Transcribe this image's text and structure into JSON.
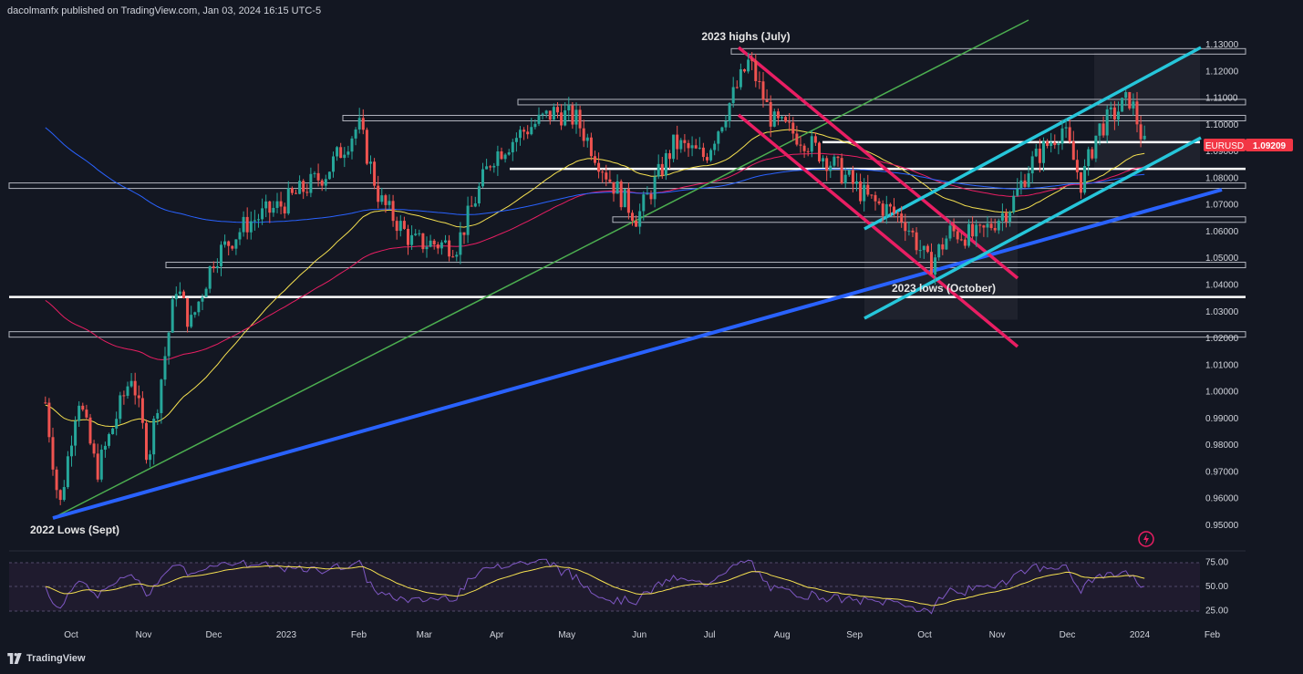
{
  "header": {
    "text": "dacolmanfx published on TradingView.com, Jan 03, 2024 16:15 UTC-5"
  },
  "footer": {
    "brand": "TradingView"
  },
  "colors": {
    "bg": "#131722",
    "up": "#26a69a",
    "down": "#ef5350",
    "ema_fast": "#f5e050",
    "ema_mid": "#e91e63",
    "ema_slow": "#2962ff",
    "rsi": "#7e57c2",
    "channel": "#26c6da",
    "trend": "#2962ff",
    "green_trend": "#4caf50",
    "down_channel": "#e91e63"
  },
  "icons": {
    "lightning": "lightning-icon"
  },
  "chart_data": {
    "type": "candlestick",
    "symbol": "EURUSD",
    "last_price": "1.09209",
    "price_ticks": [
      "1.13000",
      "1.12000",
      "1.11000",
      "1.10000",
      "1.09000",
      "1.08000",
      "1.07000",
      "1.06000",
      "1.05000",
      "1.04000",
      "1.03000",
      "1.02000",
      "1.01000",
      "1.00000",
      "0.99000",
      "0.98000",
      "0.97000",
      "0.96000",
      "0.95000"
    ],
    "ylim": [
      0.945,
      1.132
    ],
    "date_ticks": [
      "Oct",
      "Nov",
      "Dec",
      "2023",
      "Feb",
      "Mar",
      "Apr",
      "May",
      "Jun",
      "Jul",
      "Aug",
      "Sep",
      "Oct",
      "Nov",
      "Dec",
      "2024",
      "Feb"
    ],
    "annotations": [
      "2023 highs (July)",
      "2023 lows (October)",
      "2022 Lows (Sept)"
    ],
    "horizontal_levels": [
      1.1275,
      1.1085,
      1.1025,
      1.0935,
      1.0835,
      1.0775,
      1.0765,
      1.0645,
      1.0475,
      1.0355,
      1.0225,
      1.0205
    ],
    "rsi_ticks": [
      "75.00",
      "50.00",
      "25.00"
    ],
    "rsi_ylim": [
      20,
      80
    ],
    "close_path": [
      [
        "2022-09-20",
        0.996
      ],
      [
        "2022-09-26",
        0.956
      ],
      [
        "2022-10-04",
        0.999
      ],
      [
        "2022-10-12",
        0.97
      ],
      [
        "2022-10-27",
        1.007
      ],
      [
        "2022-11-03",
        0.975
      ],
      [
        "2022-11-15",
        1.04
      ],
      [
        "2022-11-21",
        1.025
      ],
      [
        "2022-12-01",
        1.05
      ],
      [
        "2022-12-15",
        1.063
      ],
      [
        "2022-12-30",
        1.07
      ],
      [
        "2023-01-18",
        1.082
      ],
      [
        "2023-02-01",
        1.1
      ],
      [
        "2023-02-10",
        1.072
      ],
      [
        "2023-02-24",
        1.056
      ],
      [
        "2023-03-15",
        1.055
      ],
      [
        "2023-03-30",
        1.088
      ],
      [
        "2023-04-13",
        1.098
      ],
      [
        "2023-04-26",
        1.105
      ],
      [
        "2023-05-05",
        1.102
      ],
      [
        "2023-05-19",
        1.08
      ],
      [
        "2023-05-31",
        1.065
      ],
      [
        "2023-06-16",
        1.093
      ],
      [
        "2023-06-29",
        1.088
      ],
      [
        "2023-07-18",
        1.124
      ],
      [
        "2023-07-28",
        1.101
      ],
      [
        "2023-08-10",
        1.095
      ],
      [
        "2023-08-23",
        1.085
      ],
      [
        "2023-09-07",
        1.072
      ],
      [
        "2023-09-22",
        1.065
      ],
      [
        "2023-10-03",
        1.047
      ],
      [
        "2023-10-12",
        1.06
      ],
      [
        "2023-10-24",
        1.058
      ],
      [
        "2023-11-07",
        1.07
      ],
      [
        "2023-11-15",
        1.085
      ],
      [
        "2023-11-29",
        1.099
      ],
      [
        "2023-12-07",
        1.078
      ],
      [
        "2023-12-14",
        1.098
      ],
      [
        "2023-12-28",
        1.11
      ],
      [
        "2024-01-02",
        1.095
      ],
      [
        "2024-01-03",
        1.0921
      ]
    ]
  }
}
